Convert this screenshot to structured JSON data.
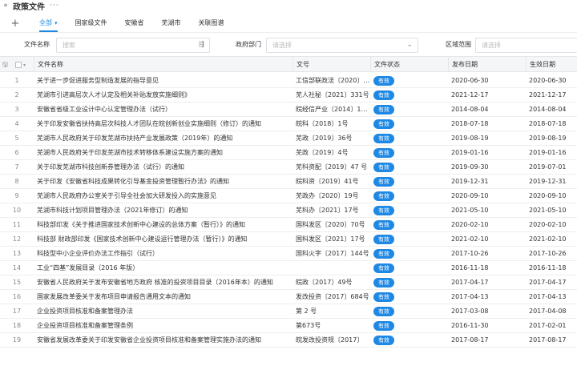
{
  "header": {
    "back_icon": "double-chevron-left-icon",
    "title": "政策文件",
    "more_icon": "ellipsis-icon"
  },
  "tabs": [
    {
      "label": "全部",
      "active": true
    },
    {
      "label": "国家级文件",
      "active": false
    },
    {
      "label": "安徽省",
      "active": false
    },
    {
      "label": "芜湖市",
      "active": false
    },
    {
      "label": "关联图谱",
      "active": false
    }
  ],
  "filters": {
    "name_label": "文件名称",
    "name_placeholder": "搜索",
    "dept_label": "政府部门",
    "dept_placeholder": "请选择",
    "region_label": "区域范围",
    "region_placeholder": "请选择"
  },
  "columns": {
    "name": "文件名称",
    "doc_no": "文号",
    "status": "文件状态",
    "publish": "发布日期",
    "effective": "生效日期"
  },
  "colors": {
    "accent": "#1e88e5"
  },
  "rows": [
    {
      "idx": "1",
      "name": "关于进一步促进服务型制造发展的指导意见",
      "doc": "工信部联政法〔2020〕101号",
      "status": "有效",
      "pub": "2020-06-30",
      "eff": "2020-06-30"
    },
    {
      "idx": "2",
      "name": "芜湖市引进高层次人才认定及相关补贴发放实施细则》",
      "doc": "芜人社秘〔2021〕331号",
      "status": "有效",
      "pub": "2021-12-17",
      "eff": "2021-12-17"
    },
    {
      "idx": "3",
      "name": "安徽省省级工业设计中心认定管理办法（试行）",
      "doc": "皖经信产业〔2014〕16号",
      "status": "有效",
      "pub": "2014-08-04",
      "eff": "2014-08-04"
    },
    {
      "idx": "4",
      "name": "关于印发安徽省扶持高层次科技人才团队在皖创新创业实施细则（修订）的通知",
      "doc": "皖科〔2018〕1号",
      "status": "有效",
      "pub": "2018-07-18",
      "eff": "2018-07-18"
    },
    {
      "idx": "5",
      "name": "芜湖市人民政府关于印发芜湖市扶持产业发展政策（2019年）的通知",
      "doc": "芜政〔2019〕36号",
      "status": "有效",
      "pub": "2019-08-19",
      "eff": "2019-08-19"
    },
    {
      "idx": "6",
      "name": "芜湖市人民政府关于印发芜湖市技术转移体系建设实施方案的通知",
      "doc": "芜政〔2019〕4号",
      "status": "有效",
      "pub": "2019-01-16",
      "eff": "2019-01-16"
    },
    {
      "idx": "7",
      "name": "关于印发芜湖市科技创新券管理办法（试行）的通知",
      "doc": "芜科资配〔2019〕47 号",
      "status": "有效",
      "pub": "2019-09-30",
      "eff": "2019-07-01"
    },
    {
      "idx": "8",
      "name": "关于印发《安徽省科技成果转化引导基金投资管理暂行办法》的通知",
      "doc": "皖科资〔2019〕41号",
      "status": "有效",
      "pub": "2019-12-31",
      "eff": "2019-12-31"
    },
    {
      "idx": "9",
      "name": "芜湖市人民政府办公室关于引导全社会加大研发投入的实施意见",
      "doc": "芜政办〔2020〕19号",
      "status": "有效",
      "pub": "2020-09-10",
      "eff": "2020-09-10"
    },
    {
      "idx": "10",
      "name": "芜湖市科技计划项目管理办法（2021年修订）的通知",
      "doc": "芜科办〔2021〕17号",
      "status": "有效",
      "pub": "2021-05-10",
      "eff": "2021-05-10"
    },
    {
      "idx": "11",
      "name": "科技部印发《关于推进国家技术创新中心建设的总体方案（暂行）》的通知",
      "doc": "国科发区〔2020〕70号",
      "status": "有效",
      "pub": "2020-02-10",
      "eff": "2020-02-10"
    },
    {
      "idx": "12",
      "name": "科技部 财政部印发《国家技术创新中心建设运行管理办法（暂行）》的通知",
      "doc": "国科发区〔2021〕17号",
      "status": "有效",
      "pub": "2021-02-10",
      "eff": "2021-02-10"
    },
    {
      "idx": "13",
      "name": "科技型中小企业评价办法工作指引（试行）",
      "doc": "国科火字〔2017〕144号",
      "status": "有效",
      "pub": "2017-10-26",
      "eff": "2017-10-26"
    },
    {
      "idx": "14",
      "name": "工业“四基”发展目录（2016 年版）",
      "doc": "",
      "status": "有效",
      "pub": "2016-11-18",
      "eff": "2016-11-18"
    },
    {
      "idx": "15",
      "name": "安徽省人民政府关于发布安徽省地方政府 核准的投资项目目录（2016年本）的通知",
      "doc": "皖政〔2017〕49号",
      "status": "有效",
      "pub": "2017-04-17",
      "eff": "2017-04-17"
    },
    {
      "idx": "16",
      "name": "国家发展改革委关于发布项目申请报告通用文本的通知",
      "doc": "发改投资〔2017〕684号",
      "status": "有效",
      "pub": "2017-04-13",
      "eff": "2017-04-13"
    },
    {
      "idx": "17",
      "name": "企业投资项目核准和备案管理办法",
      "doc": "第 2 号",
      "status": "有效",
      "pub": "2017-03-08",
      "eff": "2017-04-08"
    },
    {
      "idx": "18",
      "name": "企业投资项目核准和备案管理条例",
      "doc": "第673号",
      "status": "有效",
      "pub": "2016-11-30",
      "eff": "2017-02-01"
    },
    {
      "idx": "19",
      "name": "安徽省发展改革委关于印发安徽省企业投资项目核准和备案管理实施办法的通知",
      "doc": "皖发改投资规〔2017〕",
      "status": "有效",
      "pub": "2017-08-17",
      "eff": "2017-08-17"
    }
  ]
}
